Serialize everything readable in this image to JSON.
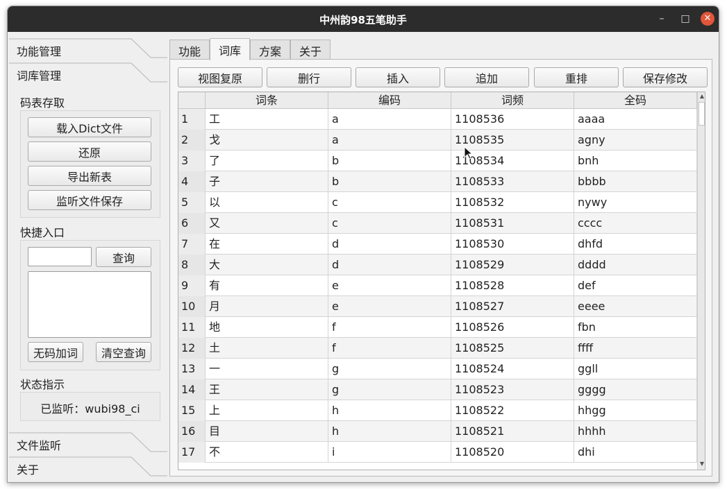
{
  "window": {
    "title": "中州韵98五笔助手"
  },
  "sidebar": {
    "func_mgmt": "功能管理",
    "dict_mgmt": "词库管理",
    "table_io": {
      "title": "码表存取",
      "load": "载入Dict文件",
      "restore": "还原",
      "export": "导出新表",
      "watch_save": "监听文件保存"
    },
    "quick": {
      "title": "快捷入口",
      "input_value": "",
      "query": "查询",
      "add_no_code": "无码加词",
      "clear": "清空查询"
    },
    "status": {
      "title": "状态指示",
      "text": "已监听：wubi98_ci"
    },
    "file_watch": "文件监听",
    "about": "关于"
  },
  "tabs": [
    "功能",
    "词库",
    "方案",
    "关于"
  ],
  "toolbar": {
    "reset_view": "视图复原",
    "delete_row": "删行",
    "insert": "插入",
    "append": "追加",
    "resort": "重排",
    "save": "保存修改"
  },
  "table": {
    "columns": [
      "词条",
      "编码",
      "词频",
      "全码"
    ],
    "rows": [
      [
        "1",
        "工",
        "a",
        "1108536",
        "aaaa"
      ],
      [
        "2",
        "戈",
        "a",
        "1108535",
        "agny"
      ],
      [
        "3",
        "了",
        "b",
        "1108534",
        "bnh"
      ],
      [
        "4",
        "子",
        "b",
        "1108533",
        "bbbb"
      ],
      [
        "5",
        "以",
        "c",
        "1108532",
        "nywy"
      ],
      [
        "6",
        "又",
        "c",
        "1108531",
        "cccc"
      ],
      [
        "7",
        "在",
        "d",
        "1108530",
        "dhfd"
      ],
      [
        "8",
        "大",
        "d",
        "1108529",
        "dddd"
      ],
      [
        "9",
        "有",
        "e",
        "1108528",
        "def"
      ],
      [
        "10",
        "月",
        "e",
        "1108527",
        "eeee"
      ],
      [
        "11",
        "地",
        "f",
        "1108526",
        "fbn"
      ],
      [
        "12",
        "土",
        "f",
        "1108525",
        "ffff"
      ],
      [
        "13",
        "一",
        "g",
        "1108524",
        "ggll"
      ],
      [
        "14",
        "王",
        "g",
        "1108523",
        "gggg"
      ],
      [
        "15",
        "上",
        "h",
        "1108522",
        "hhgg"
      ],
      [
        "16",
        "目",
        "h",
        "1108521",
        "hhhh"
      ],
      [
        "17",
        "不",
        "i",
        "1108520",
        "dhi"
      ]
    ]
  }
}
